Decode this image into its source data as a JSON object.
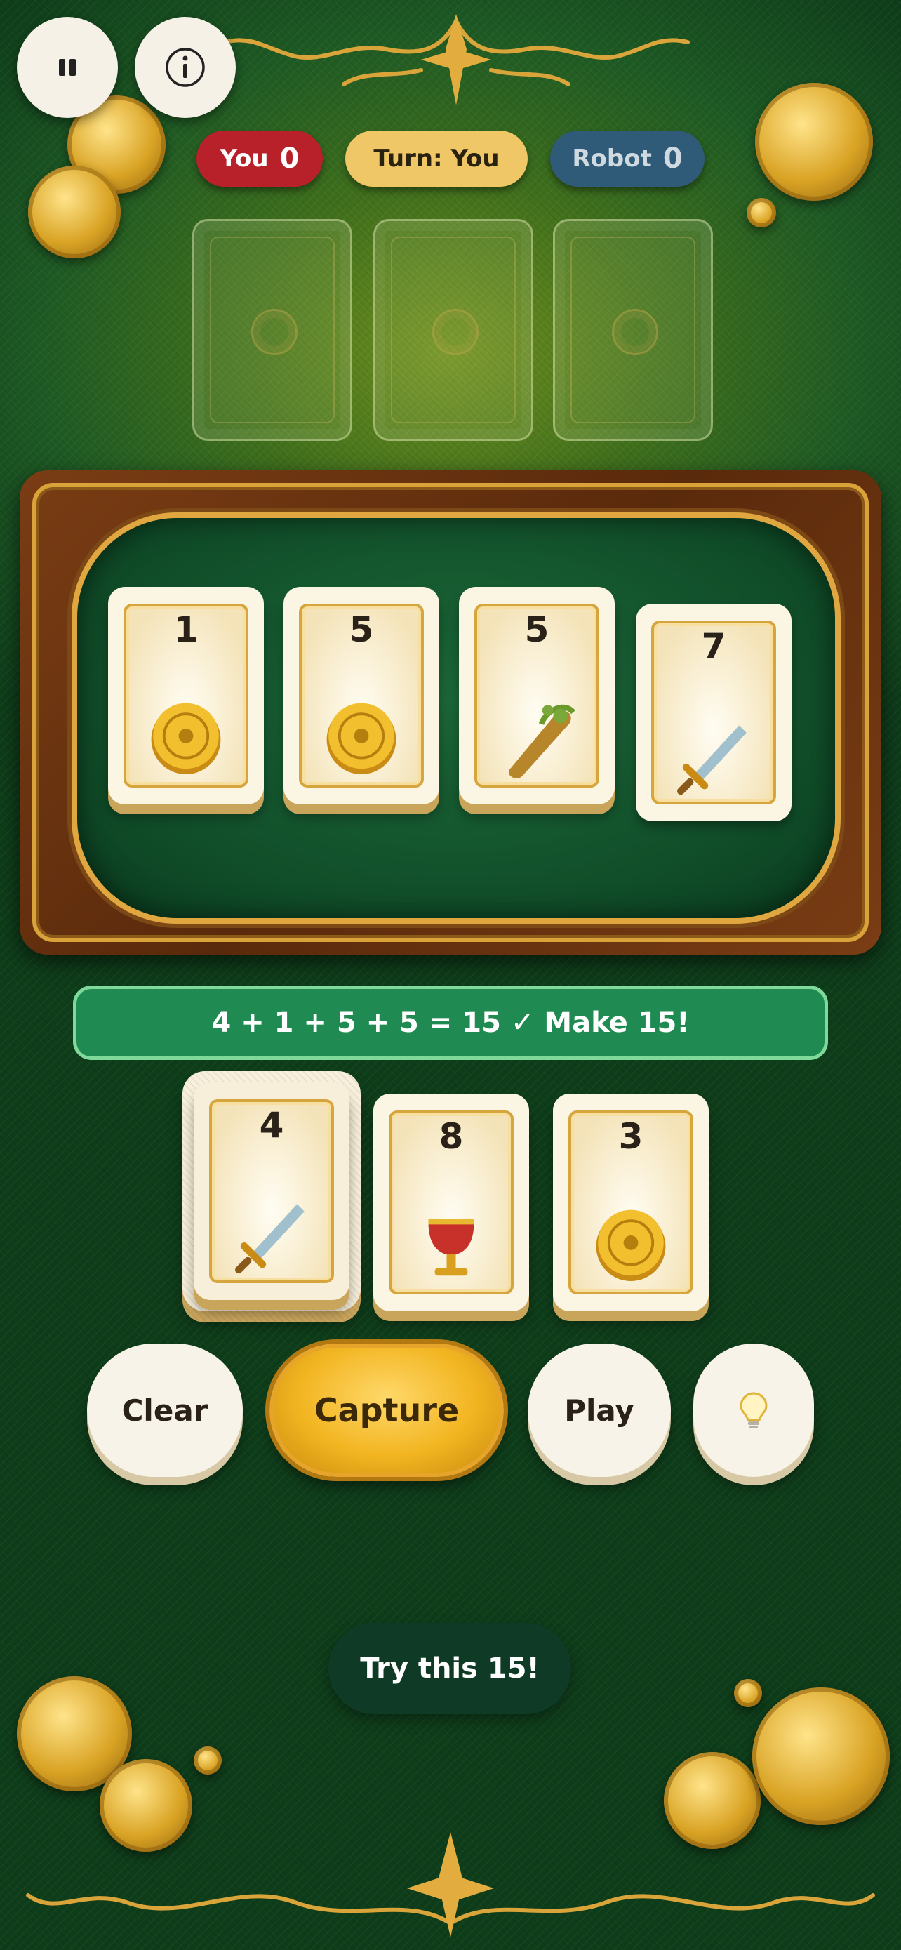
{
  "scoreboard": {
    "player_label": "You",
    "player_score": "0",
    "turn_label": "Turn: You",
    "robot_label": "Robot",
    "robot_score": "0",
    "player_color": "#b8202a",
    "turn_color": "#f0c766",
    "robot_color": "#2f5a78"
  },
  "top_buttons": {
    "pause_icon": "pause-icon",
    "info_icon": "info-icon"
  },
  "opponent_hand": {
    "count": 3
  },
  "table_cards": [
    {
      "rank": "1",
      "art": "coin-icon"
    },
    {
      "rank": "5",
      "art": "coin-icon"
    },
    {
      "rank": "5",
      "art": "club-icon"
    },
    {
      "rank": "7",
      "art": "sword-icon"
    }
  ],
  "equation": "4 + 1 + 5 + 5 = 15 ✓ Make 15!",
  "player_hand": [
    {
      "rank": "4",
      "art": "sword-icon",
      "selected": true
    },
    {
      "rank": "8",
      "art": "cup-icon",
      "selected": false
    },
    {
      "rank": "3",
      "art": "coin-icon",
      "selected": false
    }
  ],
  "actions": {
    "clear_label": "Clear",
    "capture_label": "Capture",
    "play_label": "Play",
    "hint_icon": "lightbulb-icon"
  },
  "hint_toast": "Try this 15!"
}
